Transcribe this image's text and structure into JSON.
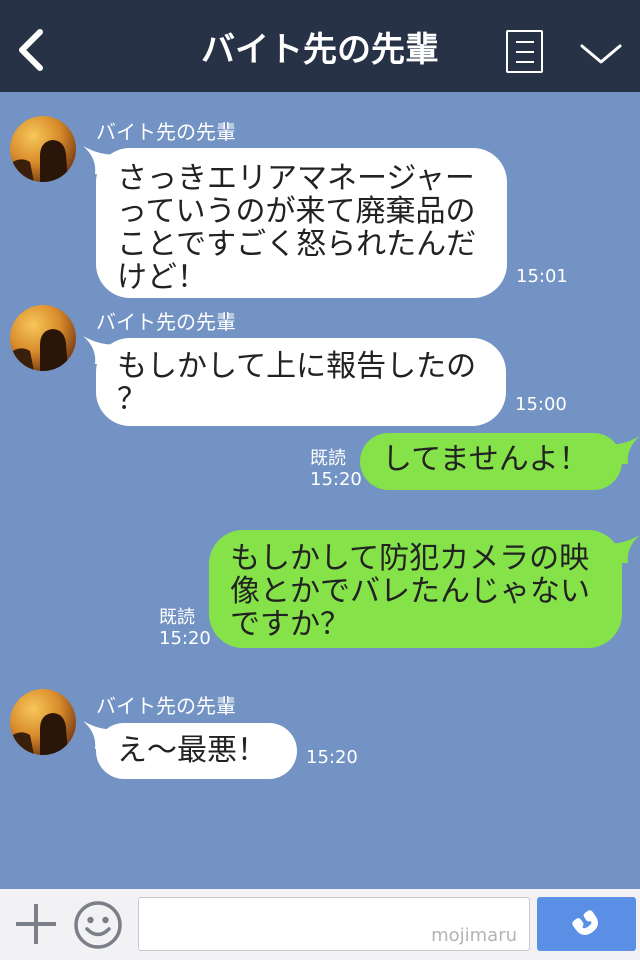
{
  "header": {
    "title": "バイト先の先輩",
    "back_icon": "chevron-left-icon",
    "menu_icon": "list-icon",
    "expand_icon": "chevron-down-icon",
    "background": "#273246"
  },
  "chat": {
    "background": "#7293c3",
    "messages": [
      {
        "direction": "incoming",
        "sender": "バイト先の先輩",
        "lines": [
          "さっきエリアマネージャー",
          "っていうのが来て廃棄品の",
          "ことですごく怒られたんだ",
          "けど！"
        ],
        "time": "15:01"
      },
      {
        "direction": "incoming",
        "sender": "バイト先の先輩",
        "lines": [
          "もしかして上に報告したの",
          "？"
        ],
        "time": "15:00"
      },
      {
        "direction": "outgoing",
        "read": "既読",
        "lines": [
          "してませんよ！"
        ],
        "time": "15:20"
      },
      {
        "direction": "outgoing",
        "read": "既読",
        "lines": [
          "もしかして防犯カメラの映",
          "像とかでバレたんじゃない",
          "ですか？"
        ],
        "time": "15:20"
      },
      {
        "direction": "incoming",
        "sender": "バイト先の先輩",
        "lines": [
          "え〜最悪！"
        ],
        "time": "15:20"
      }
    ]
  },
  "footer": {
    "plus_icon": "plus-icon",
    "emoji_icon": "smiley-icon",
    "input_value": "",
    "watermark": "mojimaru",
    "call_icon": "phone-icon",
    "call_color": "#5b8ee5"
  },
  "colors": {
    "incoming_bubble": "#ffffff",
    "outgoing_bubble": "#85e249"
  }
}
